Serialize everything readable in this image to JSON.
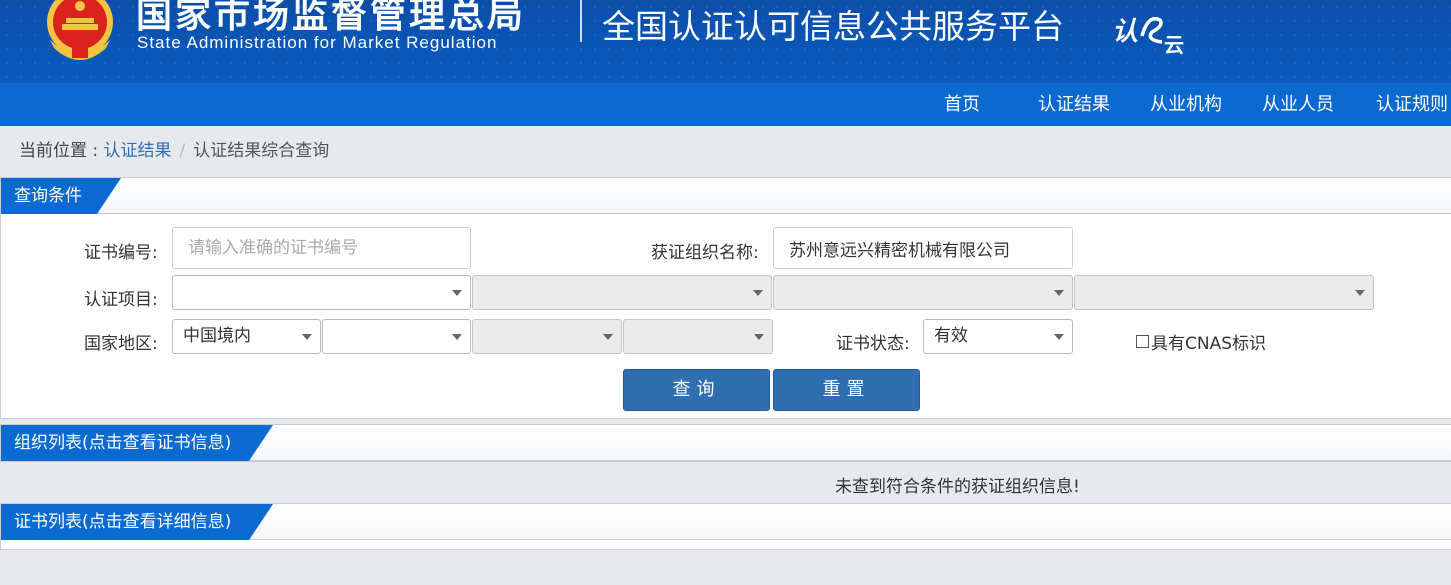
{
  "header": {
    "agency_cn": "国家市场监督管理总局",
    "agency_en": "State Administration  for  Market Regulation",
    "platform": "全国认证认可信息公共服务平台",
    "logo_text": "认e云",
    "bg_color": "#0b56b5"
  },
  "nav": {
    "items": [
      "首页",
      "认证结果",
      "从业机构",
      "从业人员",
      "认证规则"
    ]
  },
  "breadcrumb": {
    "prefix": "当前位置 : ",
    "link": "认证结果",
    "separator": "/",
    "current": "认证结果综合查询"
  },
  "query": {
    "title": "查询条件",
    "cert_no_label": "证书编号:",
    "cert_no_placeholder": "请输入准确的证书编号",
    "cert_no_value": "",
    "org_name_label": "获证组织名称:",
    "org_name_value": "苏州意远兴精密机械有限公司",
    "project_label": "认证项目:",
    "project_selects": [
      "",
      "",
      "",
      ""
    ],
    "region_label": "国家地区:",
    "region_selects": [
      "中国境内",
      "",
      "",
      ""
    ],
    "status_label": "证书状态:",
    "status_value": "有效",
    "cnas_label": "具有CNAS标识",
    "search_button": "查询",
    "reset_button": "重置"
  },
  "org_list": {
    "title": "组织列表(点击查看证书信息)",
    "empty_message": "未查到符合条件的获证组织信息!"
  },
  "cert_list": {
    "title": "证书列表(点击查看详细信息)"
  },
  "colors": {
    "nav": "#0b6ad0",
    "button": "#2f6faf",
    "link": "#2f6fb5"
  }
}
